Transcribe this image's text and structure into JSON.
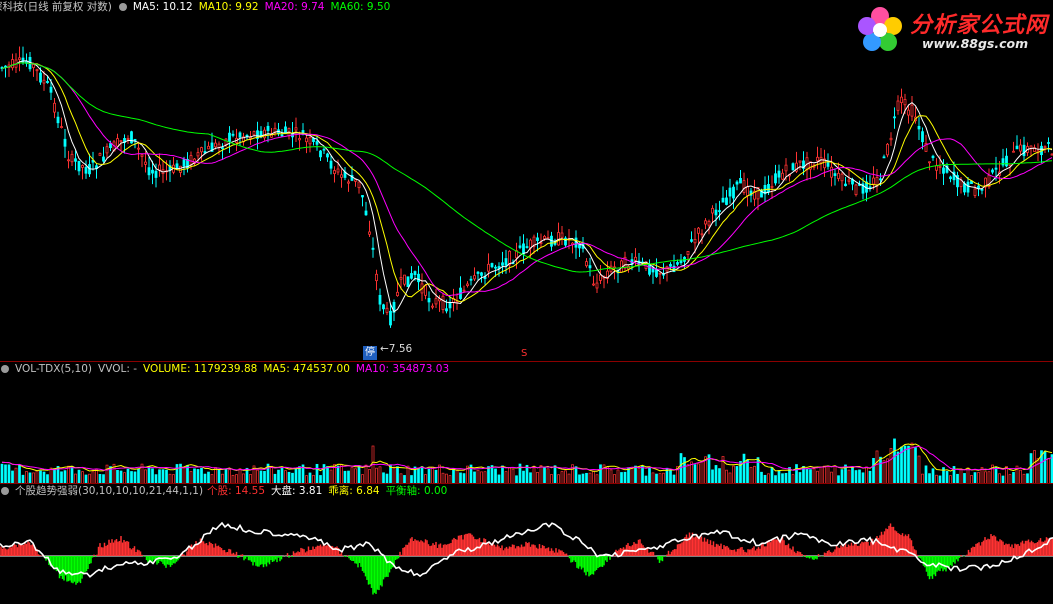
{
  "price_panel": {
    "title": "深科技(日线 前复权 对数)",
    "ma_labels": [
      {
        "text": "MA5: 10.12",
        "color": "#ffffff"
      },
      {
        "text": "MA10: 9.92",
        "color": "#ffff00"
      },
      {
        "text": "MA20: 9.74",
        "color": "#ff00ff"
      },
      {
        "text": "MA60: 9.50",
        "color": "#00ff00"
      }
    ],
    "stop_badge": "停",
    "low_marker": "←7.56",
    "red_marker": "S"
  },
  "volume_panel": {
    "title": "VOL-TDX(5,10)",
    "vvol": "VVOL: -",
    "labels": [
      {
        "text": "VOLUME: 1179239.88",
        "color": "#ffff00"
      },
      {
        "text": "MA5: 474537.00",
        "color": "#ffff00"
      },
      {
        "text": "MA10: 354873.03",
        "color": "#ff00ff"
      }
    ]
  },
  "indicator_panel": {
    "title": "个股趋势强弱(30,10,10,10,21,44,1,1)",
    "labels": [
      {
        "text": "个股: 14.55",
        "color": "#ff3030"
      },
      {
        "text": "大盘: 3.81",
        "color": "#ffffff"
      },
      {
        "text": "乖离: 6.84",
        "color": "#ffff00"
      },
      {
        "text": "平衡轴: 0.00",
        "color": "#00ff00"
      }
    ]
  },
  "logo": {
    "name": "分析家公式网",
    "url": "www.88gs.com"
  },
  "colors": {
    "up": "#ff3232",
    "down": "#00ffff",
    "ma5": "#ffffff",
    "ma10": "#ffff00",
    "ma20": "#ff00ff",
    "ma60": "#00ff00",
    "bg": "#000000",
    "separator": "#8b0000"
  },
  "chart_data": {
    "type": "candlestick",
    "y_scale": "log",
    "lowest_marked_price": 7.56,
    "ma_current": {
      "MA5": 10.12,
      "MA10": 9.92,
      "MA20": 9.74,
      "MA60": 9.5
    },
    "volume_current": {
      "VOLUME": 1179239.88,
      "MA5": 474537.0,
      "MA10": 354873.03
    },
    "indicator_current": {
      "个股": 14.55,
      "大盘": 3.81,
      "乖离": 6.84,
      "平衡轴": 0.0
    }
  }
}
